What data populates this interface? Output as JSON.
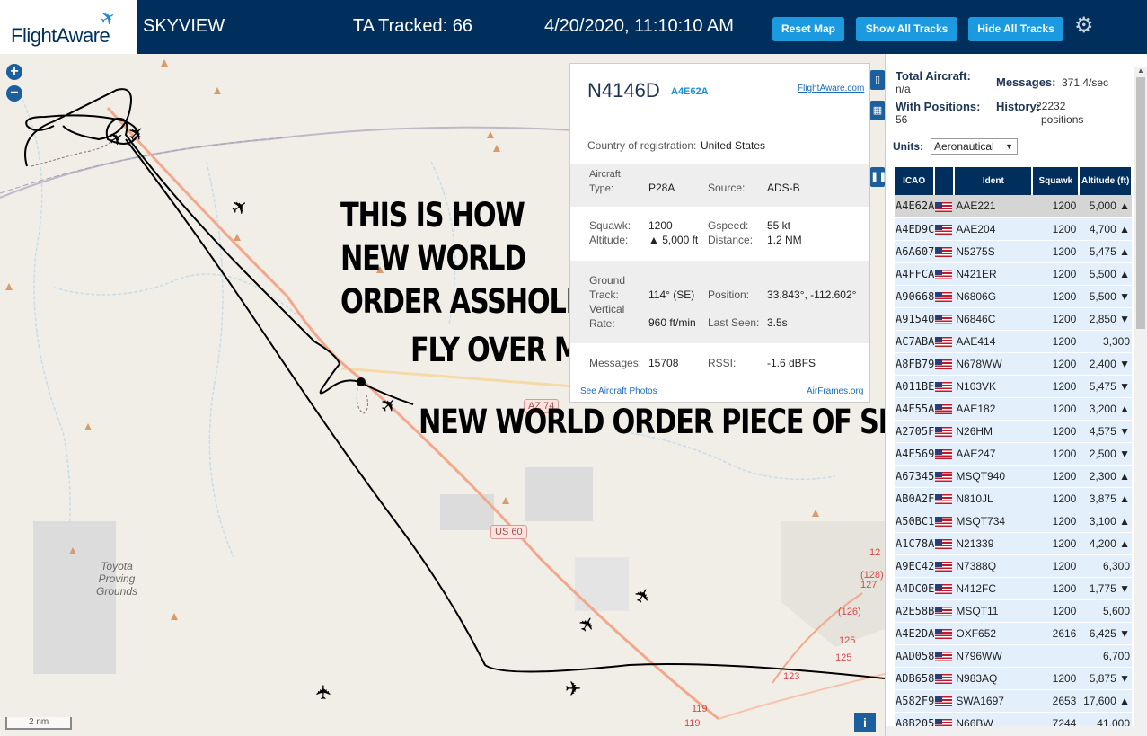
{
  "header": {
    "logo_text": "FlightAware",
    "app_name": "SKYVIEW",
    "tracked": "TA Tracked: 66",
    "datetime": "4/20/2020, 11:10:10 AM",
    "reset_map": "Reset Map",
    "show_all_tracks": "Show All Tracks",
    "hide_all_tracks": "Hide All Tracks",
    "settings_icon": "gear-icon"
  },
  "map": {
    "zoom_in": "+",
    "zoom_out": "−",
    "scale": "2 nm",
    "info": "i",
    "place_label": "Toyota Proving Grounds",
    "road_az74": "AZ 74",
    "road_us60": "US 60",
    "route_labels": [
      "(128)",
      "127",
      "(126)",
      "125",
      "125",
      "123",
      "119",
      "119"
    ],
    "overlay_lines": [
      "THIS IS HOW",
      "NEW WORLD",
      "ORDER ASSHOLES",
      "FLY OVER ME",
      "NEW WORLD ORDER PIECE OF SHIT"
    ]
  },
  "infobox": {
    "registration": "N4146D",
    "hex": "A4E62A",
    "link_fa": "FlightAware.com",
    "country_label": "Country of registration:",
    "country_value": "United States",
    "aircraft_type_label": "Aircraft\nType:",
    "aircraft_type_value": "P28A",
    "source_label": "Source:",
    "source_value": "ADS-B",
    "squawk_label": "Squawk:",
    "squawk_value": "1200",
    "altitude_label": "Altitude:",
    "altitude_value": "▲ 5,000 ft",
    "gspeed_label": "Gspeed:",
    "gspeed_value": "55 kt",
    "distance_label": "Distance:",
    "distance_value": "1.2 NM",
    "ground_track_label": "Ground\nTrack:",
    "ground_track_value": "114° (SE)",
    "position_label": "Position:",
    "position_value": "33.843°, -112.602°",
    "vertical_rate_label": "Vertical\nRate:",
    "vertical_rate_value": "960 ft/min",
    "last_seen_label": "Last Seen:",
    "last_seen_value": "3.5s",
    "messages_label": "Messages:",
    "messages_value": "15708",
    "rssi_label": "RSSI:",
    "rssi_value": "-1.6 dBFS",
    "photos_link": "See Aircraft Photos",
    "airframes_link": "AirFrames.org"
  },
  "panel": {
    "total_aircraft_label": "Total Aircraft:",
    "total_aircraft_value": "n/a",
    "messages_label": "Messages:",
    "messages_value": "371.4/sec",
    "with_positions_label": "With Positions:",
    "with_positions_value": "56",
    "history_label": "History:",
    "history_value": "22232 positions",
    "units_label": "Units:",
    "units_value": "Aeronautical",
    "columns": [
      "ICAO",
      "",
      "Ident",
      "Squawk",
      "Altitude (ft)"
    ],
    "rows": [
      {
        "icao": "A4E62A",
        "ident": "AAE221",
        "squawk": "1200",
        "altitude": "5,000 ▲"
      },
      {
        "icao": "A4ED9C",
        "ident": "AAE204",
        "squawk": "1200",
        "altitude": "4,700 ▲"
      },
      {
        "icao": "A6A607",
        "ident": "N5275S",
        "squawk": "1200",
        "altitude": "5,475 ▲"
      },
      {
        "icao": "A4FFCA",
        "ident": "N421ER",
        "squawk": "1200",
        "altitude": "5,500 ▲"
      },
      {
        "icao": "A90668",
        "ident": "N6806G",
        "squawk": "1200",
        "altitude": "5,500 ▼"
      },
      {
        "icao": "A91540",
        "ident": "N6846C",
        "squawk": "1200",
        "altitude": "2,850 ▼"
      },
      {
        "icao": "AC7ABA",
        "ident": "AAE414",
        "squawk": "1200",
        "altitude": "3,300"
      },
      {
        "icao": "A8FB79",
        "ident": "N678WW",
        "squawk": "1200",
        "altitude": "2,400 ▼"
      },
      {
        "icao": "A011BE",
        "ident": "N103VK",
        "squawk": "1200",
        "altitude": "5,475 ▼"
      },
      {
        "icao": "A4E55A",
        "ident": "AAE182",
        "squawk": "1200",
        "altitude": "3,200 ▲"
      },
      {
        "icao": "A2705F",
        "ident": "N26HM",
        "squawk": "1200",
        "altitude": "4,575 ▼"
      },
      {
        "icao": "A4E569",
        "ident": "AAE247",
        "squawk": "1200",
        "altitude": "2,500 ▼"
      },
      {
        "icao": "A67345",
        "ident": "MSQT940",
        "squawk": "1200",
        "altitude": "2,300 ▲"
      },
      {
        "icao": "AB0A2F",
        "ident": "N810JL",
        "squawk": "1200",
        "altitude": "3,875 ▲"
      },
      {
        "icao": "A50BC1",
        "ident": "MSQT734",
        "squawk": "1200",
        "altitude": "3,100 ▲"
      },
      {
        "icao": "A1C78A",
        "ident": "N21339",
        "squawk": "1200",
        "altitude": "4,200 ▲"
      },
      {
        "icao": "A9EC42",
        "ident": "N7388Q",
        "squawk": "1200",
        "altitude": "6,300"
      },
      {
        "icao": "A4DC0E",
        "ident": "N412FC",
        "squawk": "1200",
        "altitude": "1,775 ▼"
      },
      {
        "icao": "A2E58B",
        "ident": "MSQT11",
        "squawk": "1200",
        "altitude": "5,600"
      },
      {
        "icao": "A4E2DA",
        "ident": "OXF652",
        "squawk": "2616",
        "altitude": "6,425 ▼"
      },
      {
        "icao": "AAD058",
        "ident": "N796WW",
        "squawk": "",
        "altitude": "6,700"
      },
      {
        "icao": "ADB658",
        "ident": "N983AQ",
        "squawk": "1200",
        "altitude": "5,875 ▼"
      },
      {
        "icao": "A582F9",
        "ident": "SWA1697",
        "squawk": "2653",
        "altitude": "17,600 ▲"
      },
      {
        "icao": "A8B205",
        "ident": "N66BW",
        "squawk": "7244",
        "altitude": "41,000"
      }
    ]
  },
  "colors": {
    "header_bg": "#002f5d",
    "button_bg": "#1b9ae0",
    "table_row_bg": "#e3f0fb",
    "selected_row_bg": "#d5d5d5"
  }
}
